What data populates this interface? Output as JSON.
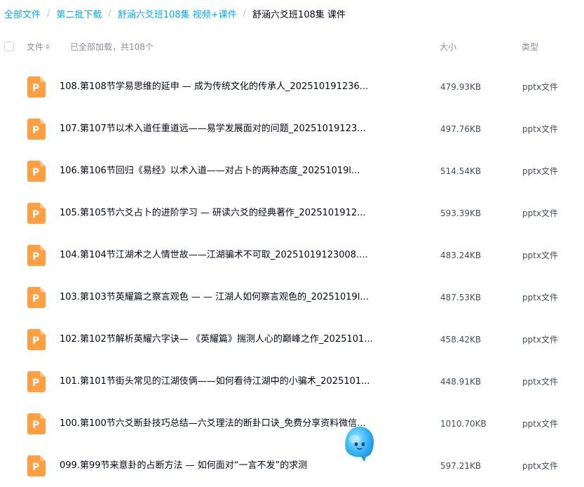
{
  "breadcrumb": {
    "items": [
      "全部文件",
      "第二批下载",
      "舒涵六爻班108集 视频+课件"
    ],
    "current": "舒涵六爻班108集 课件",
    "separator": "/"
  },
  "header": {
    "file_label": "文件",
    "load_status": "已全部加载，共108个",
    "size_label": "大小",
    "type_label": "类型"
  },
  "files": [
    {
      "name": "108.第108节学易思维的延申 — 成为传统文化的传承人_202510191236...",
      "size": "479.93KB",
      "type": "pptx文件",
      "icon": "P"
    },
    {
      "name": "107.第107节以术入道任重道远——易学发展面对的问题_20251019123...",
      "size": "497.76KB",
      "type": "pptx文件",
      "icon": "P"
    },
    {
      "name": "106.第106节回归《易经》以术入道——对占卜的两种态度_20251019l...",
      "size": "514.54KB",
      "type": "pptx文件",
      "icon": "P"
    },
    {
      "name": "105.第105节六爻占卜的进阶学习 — 研读六爻的经典著作_2025101912...",
      "size": "593.39KB",
      "type": "pptx文件",
      "icon": "P"
    },
    {
      "name": "104.第104节江湖术之人情世故——江湖骗术不可取_20251019123008....",
      "size": "483.24KB",
      "type": "pptx文件",
      "icon": "P"
    },
    {
      "name": "103.第103节英耀篇之察言观色 — — 江湖人如何察言观色的_20251019l...",
      "size": "487.53KB",
      "type": "pptx文件",
      "icon": "P"
    },
    {
      "name": "102.第102节解析英耀六字诀— 《英耀篇》揣测人心的巅峰之作_2025101...",
      "size": "458.42KB",
      "type": "pptx文件",
      "icon": "P"
    },
    {
      "name": "101.第101节街头常见的江湖伎俩——如何看待江湖中的小骗术_2025101...",
      "size": "448.91KB",
      "type": "pptx文件",
      "icon": "P"
    },
    {
      "name": "100.第100节六爻断卦技巧总结—六爻理法的断卦口诀_免费分享资料微信...",
      "size": "1010.70KB",
      "type": "pptx文件",
      "icon": "P"
    },
    {
      "name": "099.第99节来意卦的占断方法 — 如何面对“一言不发”的求测",
      "size": "597.21KB",
      "type": "pptx文件",
      "icon": "P"
    }
  ],
  "colors": {
    "link": "#06a7ff",
    "icon_bg": "#ff9f42",
    "icon_fold": "#ffc48a",
    "text": "#03081a",
    "muted": "#878c9c"
  },
  "assistant_icon": "ai-assistant-icon"
}
